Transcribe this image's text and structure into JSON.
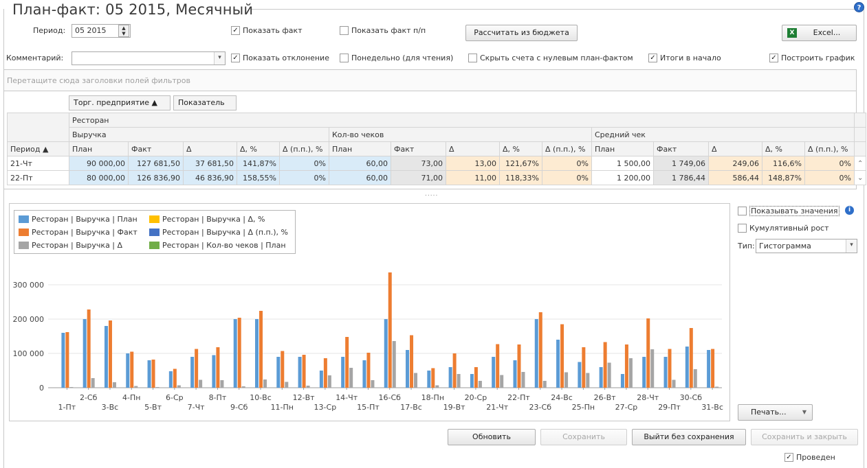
{
  "window": {
    "title": "План-факт: 05 2015, Месячный",
    "help_icon": "help-icon"
  },
  "toolbar": {
    "period_label": "Период:",
    "period_value": "05 2015",
    "comment_label": "Комментарий:",
    "comment_value": "",
    "show_fact": {
      "label": "Показать факт",
      "checked": true
    },
    "show_fact_pp": {
      "label": "Показать факт п/п",
      "checked": false
    },
    "calc_budget_button": "Рассчитать из бюджета",
    "excel_button": "Excel...",
    "show_deviation": {
      "label": "Показать отклонение",
      "checked": true
    },
    "weekly": {
      "label": "Понедельно (для чтения)",
      "checked": false
    },
    "hide_zero": {
      "label": "Скрыть счета с нулевым план-фактом",
      "checked": false
    },
    "totals_first": {
      "label": "Итоги в начало",
      "checked": true
    },
    "build_chart": {
      "label": "Построить график",
      "checked": true
    }
  },
  "filter_drop_hint": "Перетащите сюда заголовки полей фильтров",
  "pivot": {
    "column_fields": [
      "Торг. предприятие ▲",
      "Показатель"
    ],
    "row_field": "Период ▲",
    "store": "Ресторан",
    "groups": [
      "Выручка",
      "Кол-во чеков",
      "Средний чек"
    ],
    "subcolumns": [
      "План",
      "Факт",
      "Δ",
      "Δ, %",
      "Δ (п.п.), %"
    ],
    "rows": [
      {
        "period": "21-Чт",
        "cells": [
          "90 000,00",
          "127 681,50",
          "37 681,50",
          "141,87%",
          "0%",
          "60,00",
          "73,00",
          "13,00",
          "121,67%",
          "0%",
          "1 500,00",
          "1 749,06",
          "249,06",
          "116,6%",
          "0%"
        ]
      },
      {
        "period": "22-Пт",
        "cells": [
          "80 000,00",
          "126 836,90",
          "46 836,90",
          "158,55%",
          "0%",
          "60,00",
          "71,00",
          "11,00",
          "118,33%",
          "0%",
          "1 200,00",
          "1 786,44",
          "586,44",
          "148,87%",
          "0%"
        ]
      }
    ],
    "splitter": "....."
  },
  "legend": [
    {
      "label": "Ресторан | Выручка | План",
      "color": "#5b9bd5"
    },
    {
      "label": "Ресторан | Выручка | Δ, %",
      "color": "#ffc000"
    },
    {
      "label": "Ресторан | Выручка | Факт",
      "color": "#ed7d31"
    },
    {
      "label": "Ресторан | Выручка | Δ (п.п.), %",
      "color": "#4472c4"
    },
    {
      "label": "Ресторан | Выручка | Δ",
      "color": "#a5a5a5"
    },
    {
      "label": "Ресторан | Кол-во чеков | План",
      "color": "#70ad47"
    }
  ],
  "chart_data": {
    "type": "bar",
    "ylim": [
      0,
      350000
    ],
    "yticks": [
      "0",
      "100 000",
      "200 000",
      "300 000"
    ],
    "ytick_values": [
      0,
      100000,
      200000,
      300000
    ],
    "categories": [
      "1-Пт",
      "2-Сб",
      "3-Вс",
      "4-Пн",
      "5-Вт",
      "6-Ср",
      "7-Чт",
      "8-Пт",
      "9-Сб",
      "10-Вс",
      "11-Пн",
      "12-Вт",
      "13-Ср",
      "14-Чт",
      "15-Пт",
      "16-Сб",
      "17-Вс",
      "18-Пн",
      "19-Вт",
      "20-Ср",
      "21-Чт",
      "22-Пт",
      "23-Сб",
      "24-Вс",
      "25-Пн",
      "26-Вт",
      "27-Ср",
      "28-Чт",
      "29-Пт",
      "30-Сб",
      "31-Вс"
    ],
    "series": [
      {
        "name": "Ресторан | Выручка | План",
        "color": "#5b9bd5",
        "values": [
          160000,
          200000,
          180000,
          100000,
          80000,
          48000,
          90000,
          95000,
          200000,
          200000,
          90000,
          90000,
          50000,
          90000,
          80000,
          200000,
          110000,
          50000,
          60000,
          40000,
          90000,
          80000,
          200000,
          140000,
          75000,
          60000,
          40000,
          90000,
          90000,
          120000,
          110000
        ]
      },
      {
        "name": "Ресторан | Выручка | Факт",
        "color": "#ed7d31",
        "values": [
          162000,
          228000,
          196000,
          105000,
          82000,
          55000,
          113000,
          118000,
          204000,
          224000,
          107000,
          96000,
          86000,
          148000,
          102000,
          336000,
          153000,
          57000,
          100000,
          60000,
          127000,
          126000,
          220000,
          185000,
          118000,
          133000,
          126000,
          202000,
          113000,
          174000,
          113000
        ]
      },
      {
        "name": "Ресторан | Выручка | Δ",
        "color": "#a5a5a5",
        "values": [
          2000,
          28000,
          16000,
          5000,
          2000,
          7000,
          23000,
          22000,
          4000,
          24000,
          17000,
          6000,
          36000,
          58000,
          22000,
          136000,
          43000,
          7000,
          40000,
          20000,
          37000,
          46000,
          20000,
          45000,
          43000,
          73000,
          86000,
          112000,
          23000,
          54000,
          3000
        ]
      }
    ]
  },
  "side_panel": {
    "show_values": {
      "label": "Показывать значения",
      "checked": false
    },
    "cumulative": {
      "label": "Кумулятивный рост",
      "checked": false
    },
    "type_label": "Тип:",
    "type_value": "Гистограмма",
    "print_button": "Печать..."
  },
  "footer": {
    "refresh": "Обновить",
    "save": "Сохранить",
    "exit": "Выйти без сохранения",
    "save_close": "Сохранить и закрыть",
    "posted": {
      "label": "Проведен",
      "checked": true
    }
  }
}
